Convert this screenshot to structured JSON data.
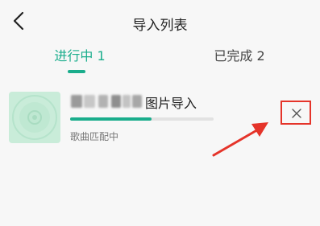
{
  "header": {
    "title": "导入列表"
  },
  "tabs": [
    {
      "label": "进行中 1",
      "active": true
    },
    {
      "label": "已完成 2",
      "active": false
    }
  ],
  "colors": {
    "accent": "#1aad8c",
    "annotation": "#e5342a"
  },
  "import_item": {
    "name_suffix": "图片导入",
    "progress": 0.57,
    "status": "歌曲匹配中"
  },
  "icons": {
    "back": "chevron-left-icon",
    "close": "close-icon"
  }
}
